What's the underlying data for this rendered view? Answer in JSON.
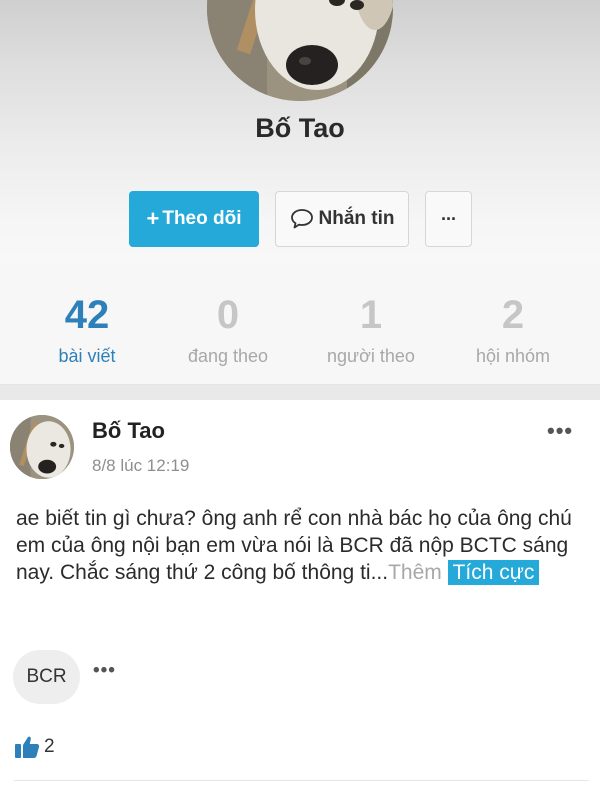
{
  "profile": {
    "name": "Bố Tao"
  },
  "actions": {
    "follow_label": "Theo dõi",
    "message_label": "Nhắn tin",
    "more_label": "···"
  },
  "stats": [
    {
      "value": "42",
      "label": "bài viết"
    },
    {
      "value": "0",
      "label": "đang theo"
    },
    {
      "value": "1",
      "label": "người theo"
    },
    {
      "value": "2",
      "label": "hội nhóm"
    }
  ],
  "post": {
    "author": "Bố Tao",
    "time": "8/8 lúc 12:19",
    "text": "ae biết tin gì chưa? ông anh rể con nhà bác họ của ông chú em của ông nội bạn em vừa nói là BCR đã nộp BCTC sáng nay. Chắc sáng thứ 2 công bố thông ti...",
    "read_more": "Thêm",
    "sentiment_tag": "Tích cực",
    "tag": "BCR",
    "like_count": "2"
  },
  "colors": {
    "accent": "#24a9d9",
    "stat_active": "#2d80ba"
  },
  "icons": [
    "plus-icon",
    "chat-bubble-icon",
    "more-dots-icon",
    "thumbs-up-icon"
  ]
}
